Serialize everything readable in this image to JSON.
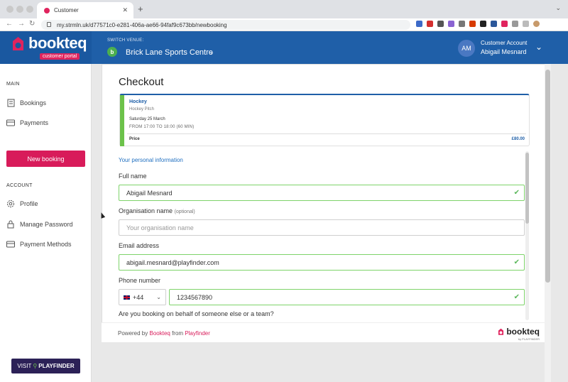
{
  "browser": {
    "tab_title": "Customer",
    "url": "my.strmln.uk/d77571c0-e281-406a-ae66-94faf9c673bb/newbooking"
  },
  "header": {
    "logo_text": "bookteq",
    "portal_badge": "customer portal",
    "venue_label": "SWITCH VENUE:",
    "venue_initial": "b",
    "venue_name": "Brick Lane Sports Centre",
    "avatar_initials": "AM",
    "account_type": "Customer Account",
    "account_name": "Abigail Mesnard"
  },
  "sidebar": {
    "main_label": "MAIN",
    "account_label": "ACCOUNT",
    "items_main": [
      {
        "label": "Bookings",
        "icon": "bookings-icon"
      },
      {
        "label": "Payments",
        "icon": "card-icon"
      }
    ],
    "new_booking": "New booking",
    "items_account": [
      {
        "label": "Profile",
        "icon": "gear-icon"
      },
      {
        "label": "Manage Password",
        "icon": "lock-icon"
      },
      {
        "label": "Payment Methods",
        "icon": "card-icon"
      }
    ],
    "visit_label": "VISIT",
    "visit_brand": "PLAYFINDER"
  },
  "checkout": {
    "title": "Checkout",
    "booking": {
      "sport": "Hockey",
      "resource": "Hockey Pitch",
      "date": "Saturday 25 March",
      "time": "FROM 17:00 TO 18:00 (60 MIN)",
      "price_label": "Price",
      "price_value": "£80.00"
    },
    "section_link": "Your personal information",
    "full_name_label": "Full name",
    "full_name_value": "Abigail Mesnard",
    "org_label": "Organisation name",
    "org_optional": "(optional)",
    "org_placeholder": "Your organisation name",
    "email_label": "Email address",
    "email_value": "abigail.mesnard@playfinder.com",
    "phone_label": "Phone number",
    "phone_code": "+44",
    "phone_value": "1234567890",
    "question": "Are you booking on behalf of someone else or a team?"
  },
  "footer": {
    "powered_by": "Powered by",
    "brand": "Bookteq",
    "from": "from",
    "company": "Playfinder",
    "logo_text": "bookteq",
    "logo_sub": "by PLAYFINDER"
  },
  "colors": {
    "brand_blue": "#1f5fa8",
    "accent_pink": "#d81b5a",
    "valid_green": "#7ed36a"
  }
}
